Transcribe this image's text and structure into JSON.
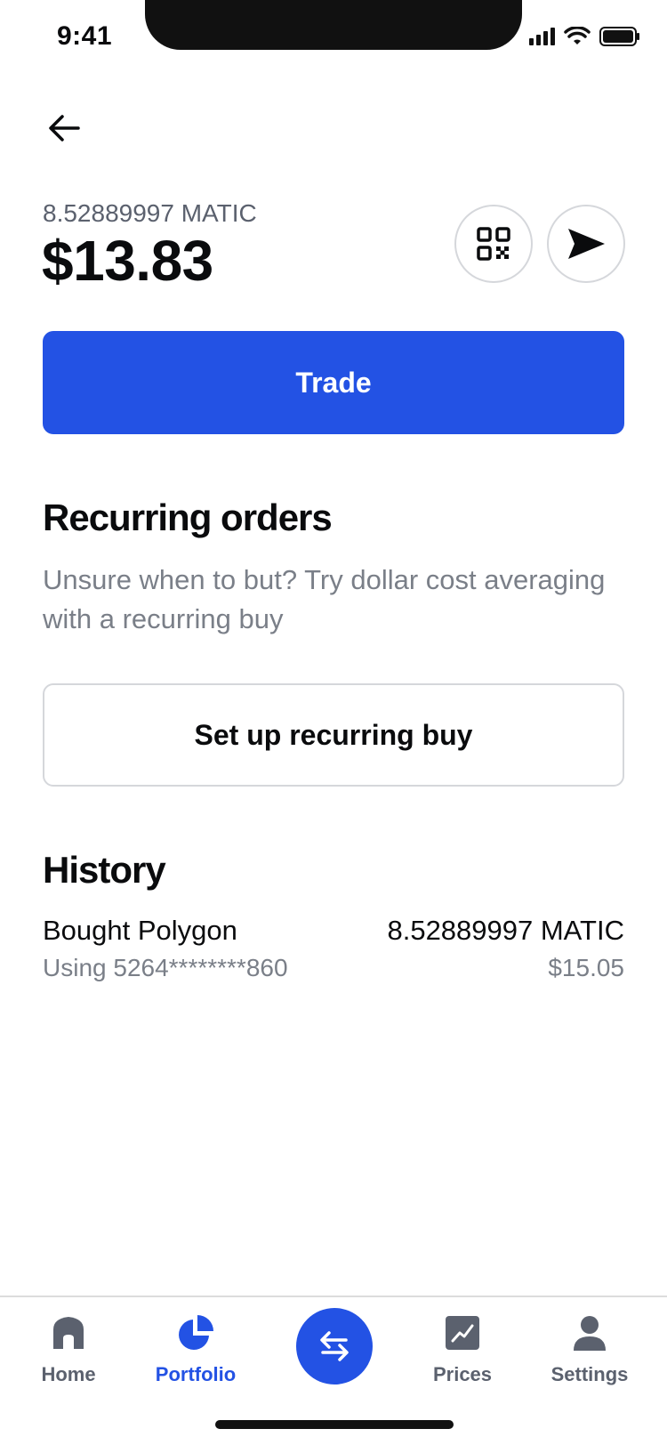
{
  "status_bar": {
    "time": "9:41"
  },
  "asset": {
    "amount": "8.52889997 MATIC",
    "balance": "$13.83"
  },
  "actions": {
    "trade_label": "Trade"
  },
  "recurring": {
    "title": "Recurring orders",
    "description": "Unsure when to but? Try dollar cost averaging with a recurring buy",
    "button_label": "Set up recurring buy"
  },
  "history": {
    "title": "History",
    "items": [
      {
        "title": "Bought Polygon",
        "subtitle": "Using 5264********860",
        "amount": "8.52889997 MATIC",
        "value": "$15.05"
      }
    ]
  },
  "tab_bar": {
    "items": [
      {
        "label": "Home",
        "icon": "home-icon"
      },
      {
        "label": "Portfolio",
        "icon": "pie-chart-icon",
        "active": true
      },
      {
        "label": "Prices",
        "icon": "chart-icon"
      },
      {
        "label": "Settings",
        "icon": "person-icon"
      }
    ],
    "center_icon": "swap-arrows-icon"
  },
  "colors": {
    "accent": "#2352e4",
    "muted": "#7a7f88",
    "text": "#0a0b0d",
    "border": "#d5d7db"
  }
}
